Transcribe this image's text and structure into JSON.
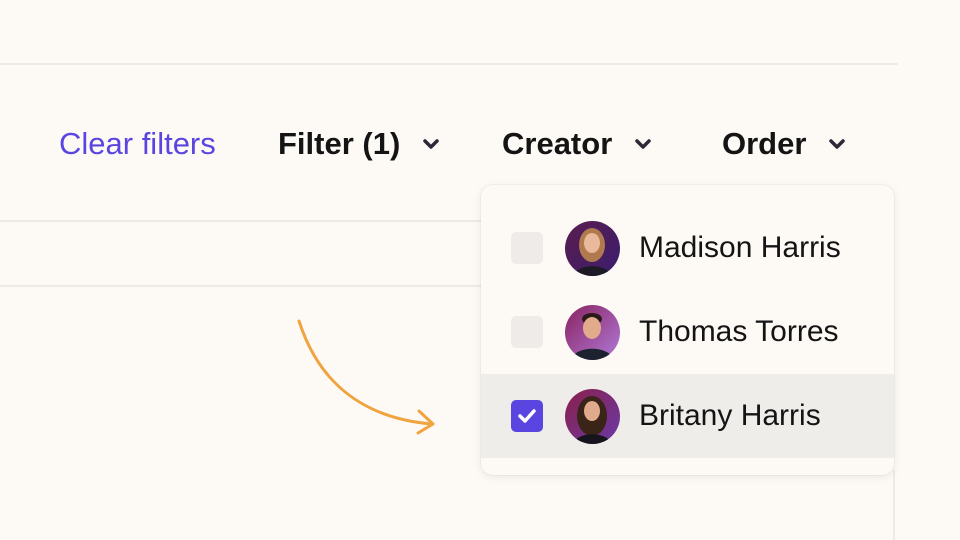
{
  "toolbar": {
    "clear_filters": "Clear filters",
    "filter": "Filter (1)",
    "creator": "Creator",
    "order": "Order"
  },
  "creator_dropdown": {
    "options": [
      {
        "name": "Madison Harris",
        "checked": false
      },
      {
        "name": "Thomas Torres",
        "checked": false
      },
      {
        "name": "Britany Harris",
        "checked": true
      }
    ]
  },
  "colors": {
    "accent": "#5b45e0",
    "annotation_arrow": "#f0a43f",
    "background": "#fdfaf6"
  }
}
